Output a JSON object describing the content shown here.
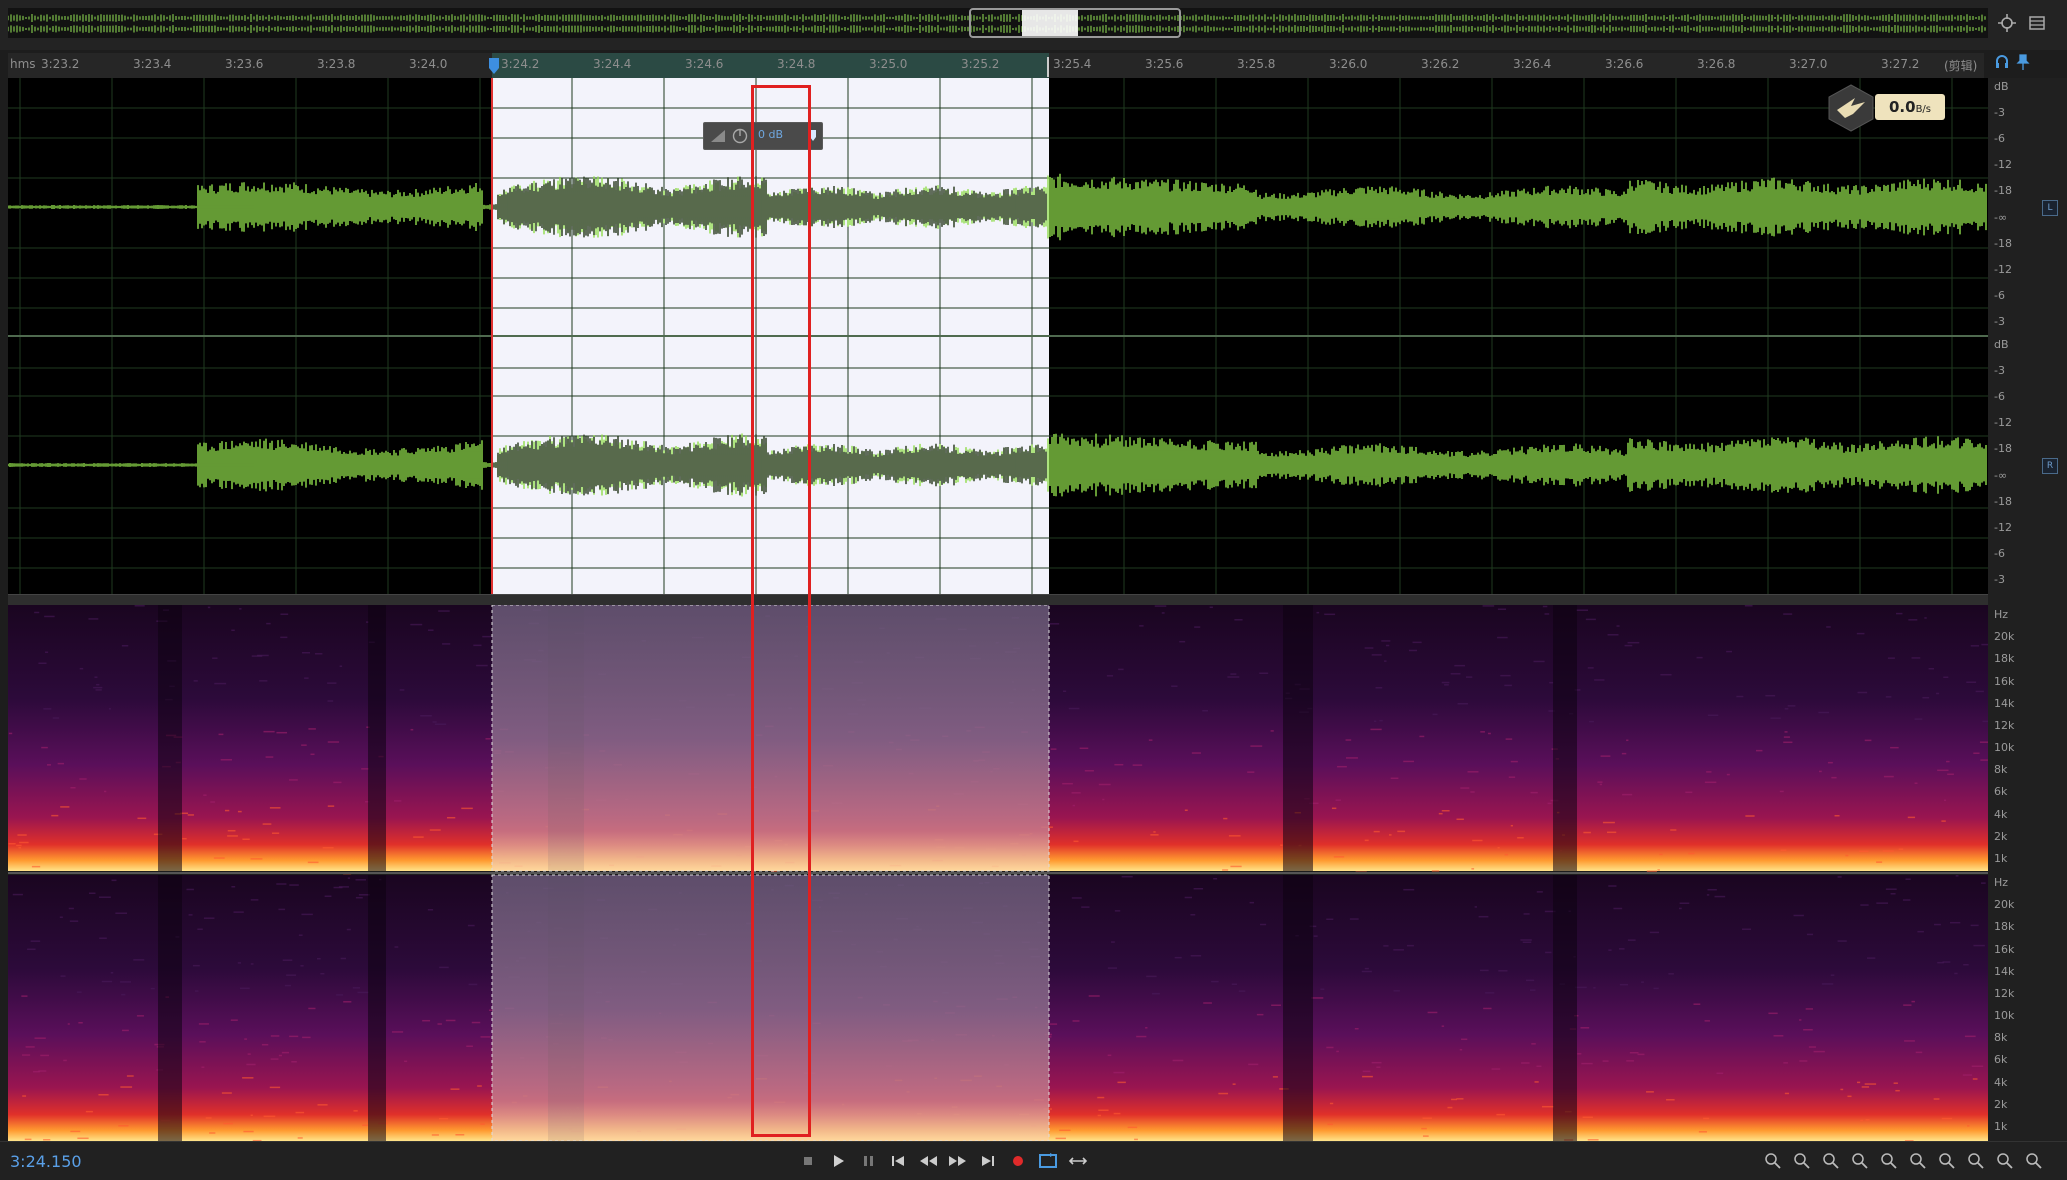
{
  "ruler": {
    "unit_label": "hms",
    "ticks": [
      "3:23.2",
      "3:23.4",
      "3:23.6",
      "3:23.8",
      "3:24.0",
      "3:24.2",
      "3:24.4",
      "3:24.6",
      "3:24.8",
      "3:25.0",
      "3:25.2",
      "3:25.4",
      "3:25.6",
      "3:25.8",
      "3:26.0",
      "3:26.2",
      "3:26.4",
      "3:26.6",
      "3:26.8",
      "3:27.0",
      "3:27.2"
    ],
    "mode_label": "(剪辑)"
  },
  "hud": {
    "gain_value": "0 dB"
  },
  "speed_badge": {
    "value": "0.0",
    "unit": "B/s"
  },
  "amplitude_scale": {
    "unit": "dB",
    "top_channel": [
      "dB",
      "-3",
      "-6",
      "-12",
      "-18",
      "-∞",
      "-18",
      "-12",
      "-6",
      "-3"
    ],
    "bottom_channel": [
      "dB",
      "-3",
      "-6",
      "-12",
      "-18",
      "-∞",
      "-18",
      "-12",
      "-6",
      "-3"
    ],
    "left_tag": "L",
    "right_tag": "R"
  },
  "frequency_scale": {
    "top_channel": [
      "Hz",
      "20k",
      "18k",
      "16k",
      "14k",
      "12k",
      "10k",
      "8k",
      "6k",
      "4k",
      "2k",
      "1k"
    ],
    "bottom_channel": [
      "Hz",
      "20k",
      "18k",
      "16k",
      "14k",
      "12k",
      "10k",
      "8k",
      "6k",
      "4k",
      "2k",
      "1k"
    ]
  },
  "transport": {
    "timecode": "3:24.150",
    "buttons": [
      "stop-icon",
      "play-icon",
      "pause-icon",
      "go-to-start-icon",
      "rewind-icon",
      "fast-forward-icon",
      "go-to-end-icon",
      "record-icon",
      "loop-icon",
      "skip-selection-icon"
    ]
  },
  "zoom_tools": [
    "zoom-in-amplitude-icon",
    "zoom-out-amplitude-icon",
    "zoom-in-time-icon",
    "zoom-out-time-icon",
    "zoom-selection-icon",
    "zoom-in-left-icon",
    "zoom-in-right-icon",
    "zoom-out-full-icon",
    "zoom-reset-icon",
    "zoom-settings-icon"
  ],
  "colors": {
    "waveform": "#8fdc4a",
    "selection_bg": "#f2f2fb",
    "selection_wave": "#3b4a33",
    "marker": "#e02020",
    "timecode": "#5aa0e8"
  }
}
